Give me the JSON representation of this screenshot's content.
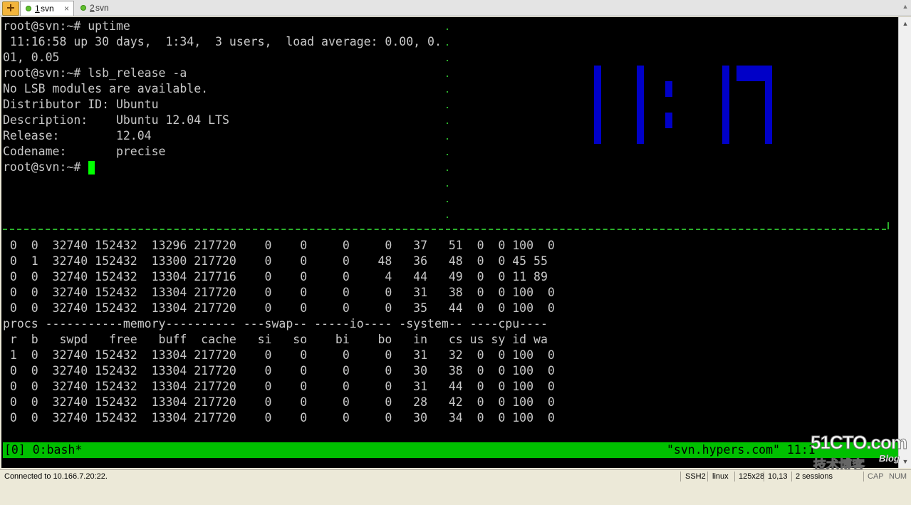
{
  "tabs": [
    {
      "number": "1",
      "label": "svn",
      "close": "×"
    },
    {
      "number": "2",
      "label": "svn"
    }
  ],
  "terminal": {
    "top_lines": [
      "root@svn:~# uptime",
      " 11:16:58 up 30 days,  1:34,  3 users,  load average: 0.00, 0.",
      "01, 0.05",
      "root@svn:~# lsb_release -a",
      "No LSB modules are available.",
      "Distributor ID: Ubuntu",
      "Description:    Ubuntu 12.04 LTS",
      "Release:        12.04",
      "Codename:       precise",
      "root@svn:~# "
    ],
    "clock_time": "11:17",
    "vmstat_lines": [
      " 0  0  32740 152432  13296 217720    0    0     0     0   37   51  0  0 100  0",
      " 0  1  32740 152432  13300 217720    0    0     0    48   36   48  0  0 45 55",
      " 0  0  32740 152432  13304 217716    0    0     0     4   44   49  0  0 11 89",
      " 0  0  32740 152432  13304 217720    0    0     0     0   31   38  0  0 100  0",
      " 0  0  32740 152432  13304 217720    0    0     0     0   35   44  0  0 100  0",
      "procs -----------memory---------- ---swap-- -----io---- -system-- ----cpu----",
      " r  b   swpd   free   buff  cache   si   so    bi    bo   in   cs us sy id wa",
      " 1  0  32740 152432  13304 217720    0    0     0     0   31   32  0  0 100  0",
      " 0  0  32740 152432  13304 217720    0    0     0     0   30   38  0  0 100  0",
      " 0  0  32740 152432  13304 217720    0    0     0     0   31   44  0  0 100  0",
      " 0  0  32740 152432  13304 217720    0    0     0     0   28   42  0  0 100  0",
      " 0  0  32740 152432  13304 217720    0    0     0     0   30   34  0  0 100  0"
    ],
    "tmux_left": "[0] 0:bash*",
    "tmux_right": "\"svn.hypers.com\" 11:1"
  },
  "watermark": {
    "main": "51CTO.com",
    "sub": "技术博客",
    "blog": "Blog"
  },
  "statusbar": {
    "connection": "Connected to 10.166.7.20:22.",
    "protocol": "SSH2",
    "terminal_type": "linux",
    "size": "125x28",
    "cursor_pos": "10,13",
    "sessions": "2 sessions",
    "cap": "CAP",
    "num": "NUM"
  },
  "colors": {
    "terminal_bg": "#000000",
    "terminal_fg": "#c8c8c8",
    "cursor": "#00ff00",
    "tmux_bar": "#00c000",
    "clock": "#0000c8",
    "separator": "#2bb02b"
  }
}
